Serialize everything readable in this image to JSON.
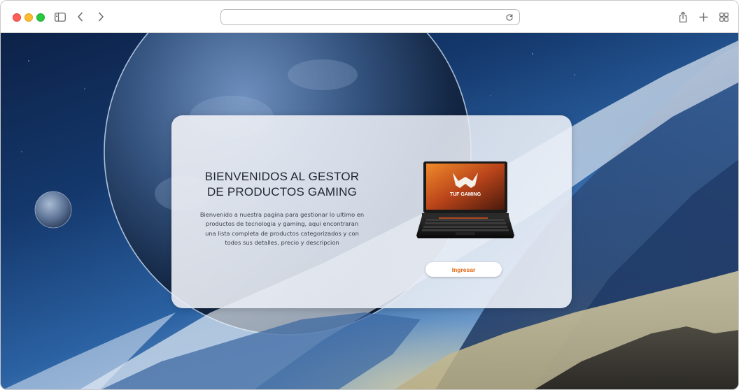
{
  "browser": {
    "address": "",
    "icons": [
      "sidebar-icon",
      "back-icon",
      "forward-icon",
      "reload-icon",
      "share-icon",
      "new-tab-icon",
      "tab-overview-icon"
    ]
  },
  "card": {
    "title": "BIENVENIDOS AL GESTOR DE PRODUCTOS GAMING",
    "description": "Bienvenido a nuestra pagina para gestionar lo ultimo en productos de tecnologia y gaming, aqui encontraran una lista completa de productos categorizados y con todos sus detalles, precio y descripcion",
    "laptop_brand": "TUF GAMING",
    "button_label": "Ingresar"
  },
  "colors": {
    "button_text": "#e2650b",
    "space_dark": "#0d2248",
    "space_mid": "#2b62a3"
  }
}
